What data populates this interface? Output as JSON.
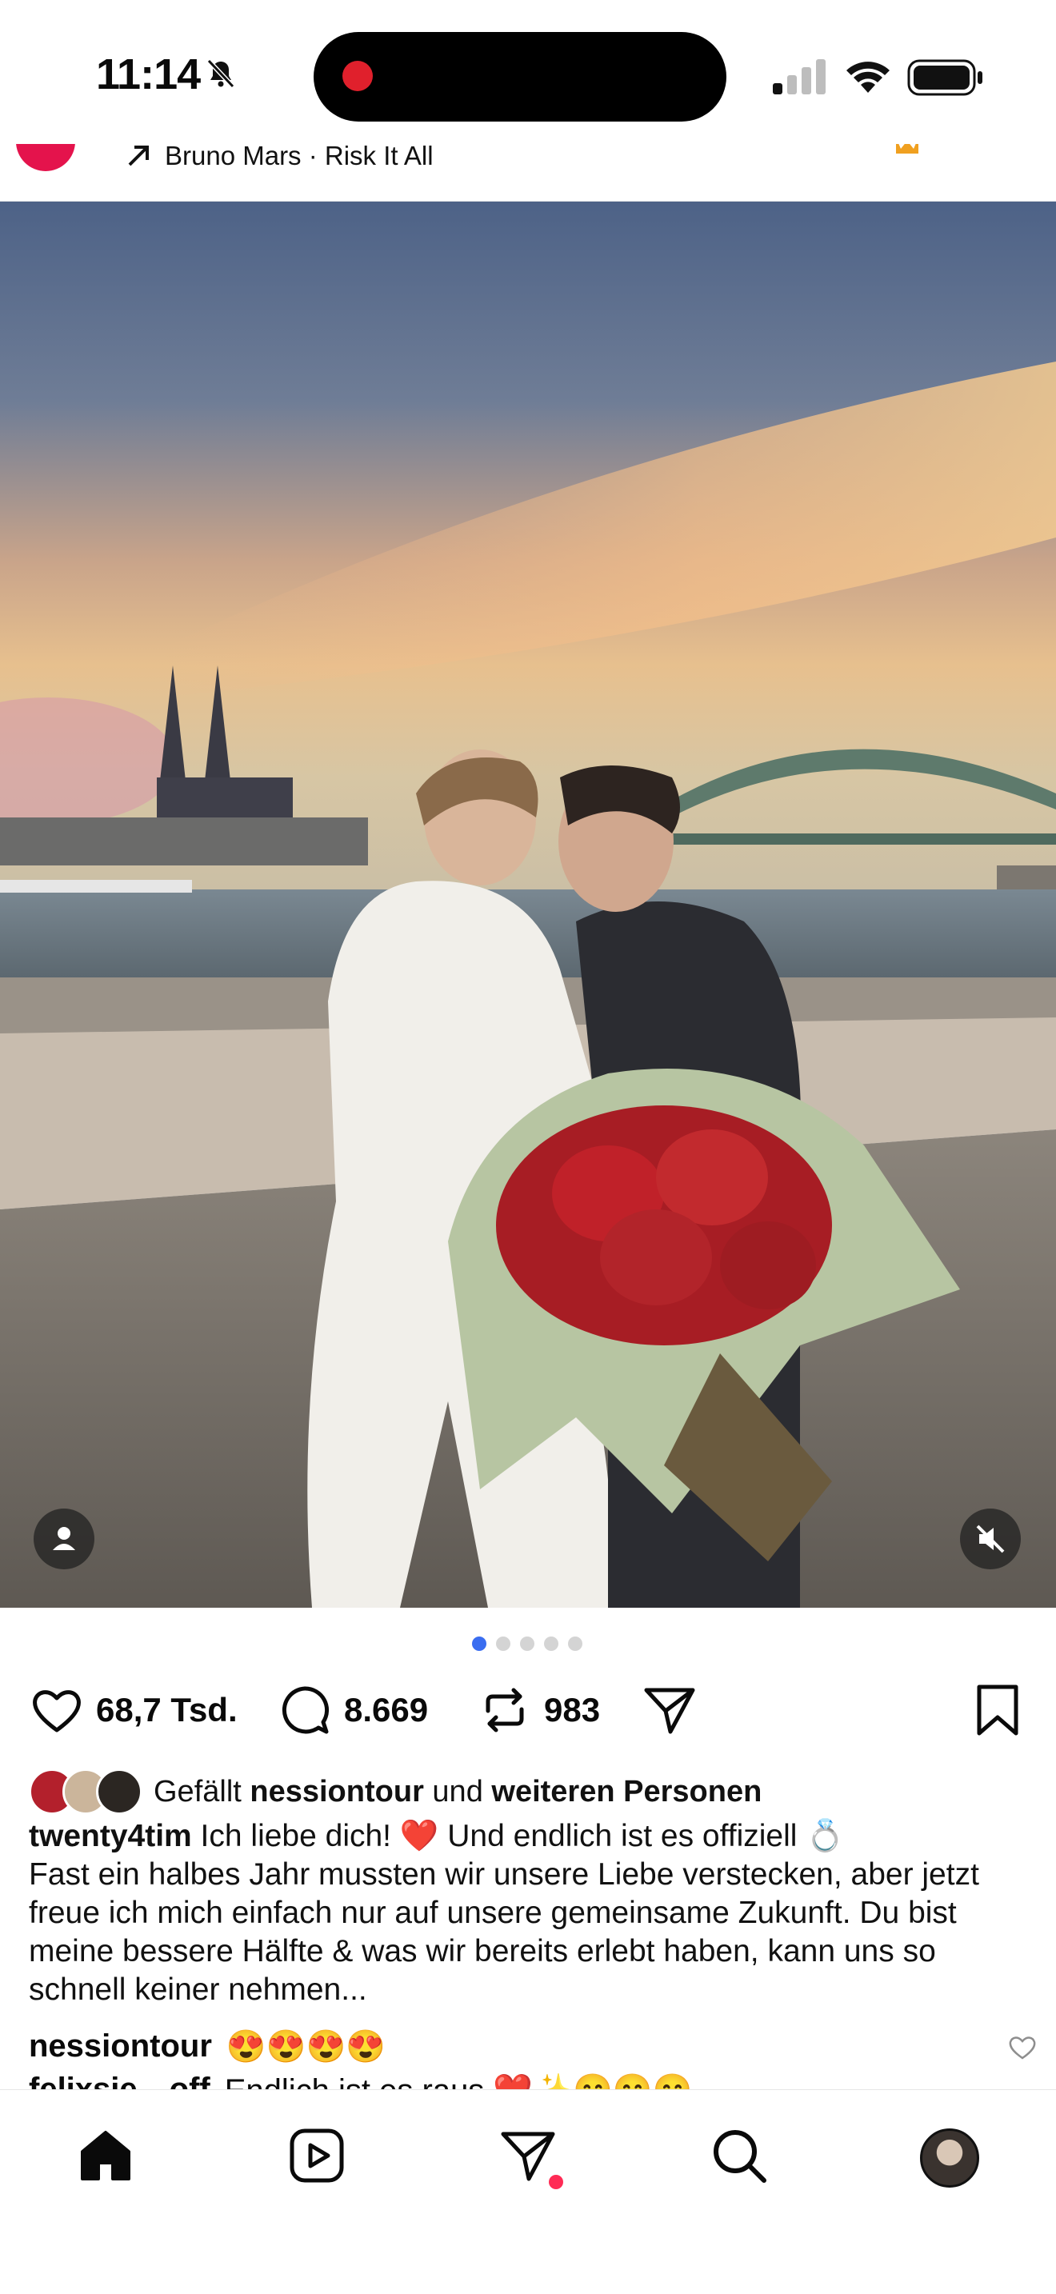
{
  "status_bar": {
    "time": "11:14",
    "icons": [
      "bell-slash-icon",
      "recording-dot",
      "signal-icon",
      "wifi-icon",
      "battery-icon"
    ]
  },
  "post": {
    "music": "Bruno Mars · Risk It All",
    "carousel": {
      "count": 5,
      "active_index": 0
    },
    "likes_count": "68,7 Tsd.",
    "comments_count": "8.669",
    "reposts_count": "983",
    "liked_by": {
      "prefix": "Gefällt",
      "user": "nessiontour",
      "middle": "und",
      "others": "weiteren Personen"
    },
    "caption": {
      "username": "twenty4tim",
      "line1": "Ich liebe dich! ❤️ Und endlich ist es offiziell 💍",
      "line2": "Fast ein halbes Jahr mussten wir unsere Liebe verstecken, aber jetzt freue ich mich einfach nur auf unsere gemeinsame Zukunft. Du bist meine bessere Hälfte & was wir bereits erlebt haben, kann uns so schnell keiner nehmen..."
    },
    "comments": [
      {
        "username": "nessiontour",
        "text": "😍😍😍😍"
      },
      {
        "username": "felixsie…off",
        "text": "Endlich ist es raus ❤️✨😄😄😄"
      }
    ]
  },
  "nav": {
    "items": [
      "home-icon",
      "reels-icon",
      "direct-messages-icon",
      "search-icon",
      "profile-avatar"
    ]
  },
  "colors": {
    "accent_blue": "#3a6df0",
    "notification_red": "#ff2b55",
    "recording_red": "#e0202c"
  }
}
